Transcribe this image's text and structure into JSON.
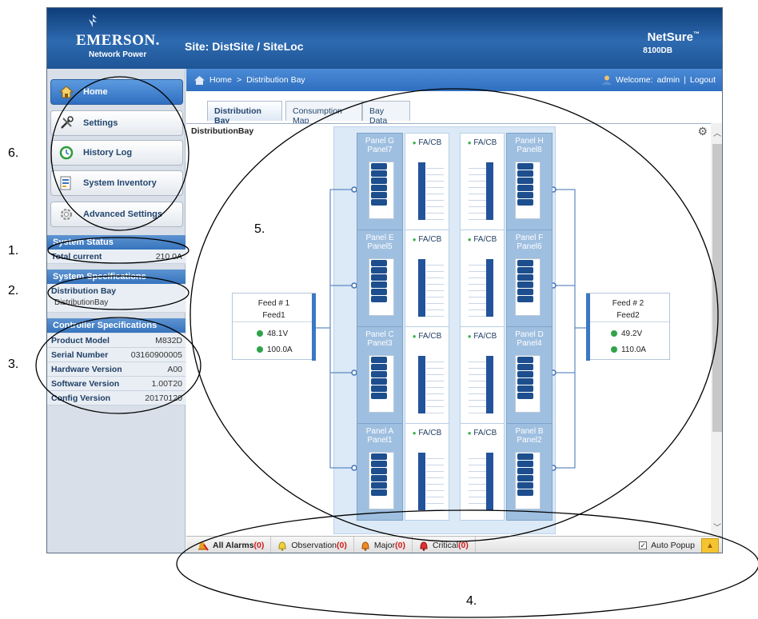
{
  "header": {
    "brand": "EMERSON.",
    "brand_sub": "Network Power",
    "site": "Site: DistSite / SiteLoc",
    "product": "NetSure",
    "product_tm": "™",
    "model": "8100DB"
  },
  "nav": [
    {
      "label": "Home",
      "icon": "home-icon",
      "active": true
    },
    {
      "label": "Settings",
      "icon": "tools-icon"
    },
    {
      "label": "History Log",
      "icon": "clock-icon"
    },
    {
      "label": "System Inventory",
      "icon": "inventory-icon"
    },
    {
      "label": "Advanced Settings",
      "icon": "gear-icon"
    }
  ],
  "system_status": {
    "title": "System Status",
    "rows": [
      {
        "key": "Total current",
        "value": "210.0A"
      }
    ]
  },
  "system_spec": {
    "title": "System Specifications",
    "key": "Distribution Bay",
    "value": "DistributionBay"
  },
  "controller_spec": {
    "title": "Controller Specifications",
    "rows": [
      {
        "key": "Product Model",
        "value": "M832D"
      },
      {
        "key": "Serial Number",
        "value": "03160900005"
      },
      {
        "key": "Hardware Version",
        "value": "A00"
      },
      {
        "key": "Software Version",
        "value": "1.00T20"
      },
      {
        "key": "Config Version",
        "value": "20170120"
      }
    ]
  },
  "breadcrumb": {
    "home": "Home",
    "sep": ">",
    "current": "Distribution Bay",
    "welcome": "Welcome:",
    "user": "admin",
    "divider": "|",
    "logout": "Logout"
  },
  "tabs": [
    "Distribution Bay",
    "Consumption Map",
    "Bay Data"
  ],
  "bay": {
    "title": "DistributionBay",
    "fa_label": "FA/CB",
    "left_panels": [
      {
        "name": "Panel G",
        "sub": "Panel7"
      },
      {
        "name": "Panel E",
        "sub": "Panel5"
      },
      {
        "name": "Panel C",
        "sub": "Panel3"
      },
      {
        "name": "Panel A",
        "sub": "Panel1"
      }
    ],
    "right_panels": [
      {
        "name": "Panel H",
        "sub": "Panel8"
      },
      {
        "name": "Panel F",
        "sub": "Panel6"
      },
      {
        "name": "Panel D",
        "sub": "Panel4"
      },
      {
        "name": "Panel B",
        "sub": "Panel2"
      }
    ]
  },
  "feeds": [
    {
      "title": "Feed # 1",
      "name": "Feed1",
      "voltage": "48.1V",
      "current": "100.0A"
    },
    {
      "title": "Feed # 2",
      "name": "Feed2",
      "voltage": "49.2V",
      "current": "110.0A"
    }
  ],
  "alarms": {
    "all": "All Alarms",
    "all_count": "(0)",
    "observation": "Observation",
    "observation_count": "(0)",
    "major": "Major",
    "major_count": "(0)",
    "critical": "Critical",
    "critical_count": "(0)",
    "auto_popup": "Auto Popup"
  },
  "annotations": [
    "1.",
    "2.",
    "3.",
    "4.",
    "5.",
    "6."
  ],
  "colors": {
    "header": "#1e5596",
    "accent": "#3674bd",
    "ok": "#2ea34a",
    "alarm_count": "#d21a1a"
  }
}
